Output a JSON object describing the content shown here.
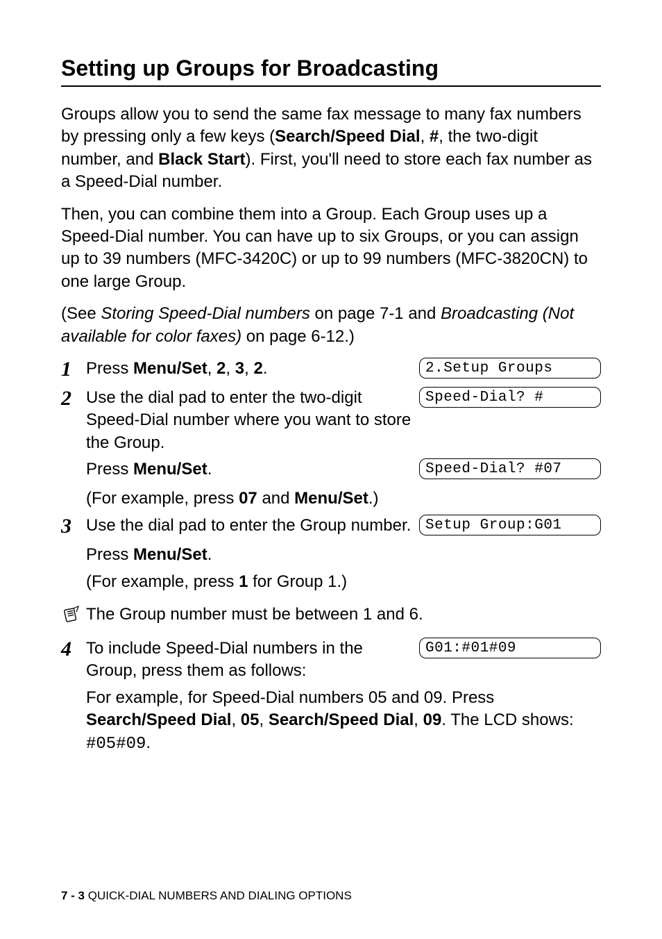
{
  "title": "Setting up Groups for Broadcasting",
  "intro": {
    "p1_a": "Groups allow you to send the same fax message to many fax numbers by pressing only a few keys (",
    "p1_b1": "Search/Speed Dial",
    "p1_c": ", ",
    "p1_b2": "#",
    "p1_d": ", the two-digit number, and ",
    "p1_b3": "Black Start",
    "p1_e": "). First, you'll need to store each fax number as a Speed-Dial number.",
    "p2": "Then, you can combine them into a Group. Each Group uses up a Speed-Dial number. You can have up to six Groups, or you can assign up to 39 numbers (MFC-3420C) or up to 99 numbers (MFC-3820CN) to one large Group.",
    "p3_a": "(See ",
    "p3_i1": "Storing Speed-Dial numbers",
    "p3_b": " on page 7-1 and ",
    "p3_i2": "Broadcasting (Not available for color faxes)",
    "p3_c": " on page 6-12.)"
  },
  "steps": {
    "n1": "1",
    "n2": "2",
    "n3": "3",
    "n4": "4",
    "s1_a": "Press ",
    "s1_b1": "Menu/Set",
    "s1_c": ", ",
    "s1_b2": "2",
    "s1_d": ", ",
    "s1_b3": "3",
    "s1_e": ", ",
    "s1_b4": "2",
    "s1_f": ".",
    "s2_a": "Use the dial pad to enter the two-digit Speed-Dial number where you want to store the Group.",
    "s2_b": "Press ",
    "s2_b1": "Menu/Set",
    "s2_c": ".",
    "s2_d": "(For example, press ",
    "s2_d1": "07",
    "s2_e": " and ",
    "s2_d2": "Menu/Set",
    "s2_f": ".)",
    "s3_a": "Use the dial pad to enter the Group number.",
    "s3_b": "Press ",
    "s3_b1": "Menu/Set",
    "s3_c": ".",
    "s3_d": "(For example, press ",
    "s3_d1": "1",
    "s3_e": " for Group 1.)",
    "note": "The Group number must be between 1 and 6.",
    "s4_a": "To include Speed-Dial numbers in the Group, press them as follows:",
    "s4_b": "For example, for Speed-Dial numbers 05 and 09. Press ",
    "s4_b1": "Search/Speed Dial",
    "s4_c": ", ",
    "s4_b2": "05",
    "s4_d": ", ",
    "s4_b3": "Search/Speed Dial",
    "s4_e": ", ",
    "s4_b4": "09",
    "s4_f": ". The LCD shows: ",
    "s4_mono": "#05#09",
    "s4_g": "."
  },
  "lcd": {
    "d1": "2.Setup Groups",
    "d2": "Speed-Dial? #",
    "d3": "Speed-Dial? #07",
    "d4": "Setup Group:G01",
    "d5": "G01:#01#09"
  },
  "footer": {
    "page": "7 - 3",
    "chapter": "   QUICK-DIAL NUMBERS AND DIALING OPTIONS"
  }
}
